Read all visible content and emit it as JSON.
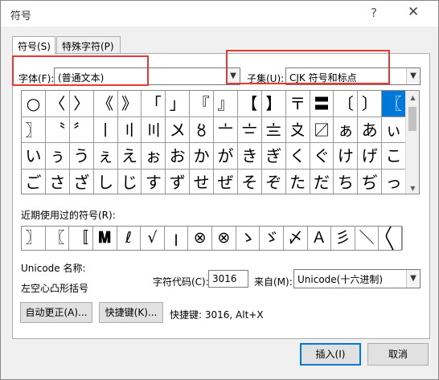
{
  "window": {
    "title": "符号",
    "help_glyph": "?",
    "close_glyph": "✕"
  },
  "tabs": [
    {
      "label": "符号(S)",
      "active": true
    },
    {
      "label": "特殊字符(P)",
      "active": false
    }
  ],
  "font": {
    "label": "字体(F):",
    "value": "(普通文本)"
  },
  "subset": {
    "label": "子集(U):",
    "value": "CJK 符号和标点"
  },
  "symbol_grid": {
    "cells": [
      "○",
      "〈",
      "〉",
      "《",
      "》",
      "「",
      "」",
      "『",
      "』",
      "【",
      "】",
      "〒",
      "〓",
      "〔",
      "〕",
      "〖",
      "〗",
      "〝",
      "〞",
      "〡",
      "〢",
      "〣",
      "〤",
      "〥",
      "〦",
      "〧",
      "〨",
      "〩",
      "〼",
      "ぁ",
      "あ",
      "ぃ",
      "い",
      "ぅ",
      "う",
      "ぇ",
      "え",
      "ぉ",
      "お",
      "か",
      "が",
      "き",
      "ぎ",
      "く",
      "ぐ",
      "け",
      "げ",
      "こ",
      "ご",
      "さ",
      "ざ",
      "し",
      "じ",
      "す",
      "ず",
      "せ",
      "ぜ",
      "そ",
      "ぞ",
      "た",
      "だ",
      "ち",
      "ぢ",
      "っ"
    ],
    "selected_index": 15
  },
  "recent": {
    "label": "近期使用过的符号(R):",
    "cells": [
      "〗",
      "〖",
      "〚",
      "𝐌",
      "ℓ",
      "√",
      "ꞁ",
      "⊗",
      "⊗",
      "ゝ",
      "ゞ",
      "〆",
      "Ａ",
      "彡",
      "＼",
      "〱",
      "、"
    ]
  },
  "unicode": {
    "name_label": "Unicode 名称:",
    "name_value": "左空心凸形括号",
    "code_label": "字符代码(C):",
    "code_value": "3016",
    "from_label": "来自(M):",
    "from_value": "Unicode(十六进制)"
  },
  "buttons": {
    "autocorrect": "自动更正(A)...",
    "shortcut": "快捷键(K)...",
    "shortcut_info": "快捷键: 3016, Alt+X",
    "insert": "插入(I)",
    "cancel": "取消"
  },
  "colors": {
    "selection": "#0078d7",
    "highlight_box": "#e53935"
  }
}
